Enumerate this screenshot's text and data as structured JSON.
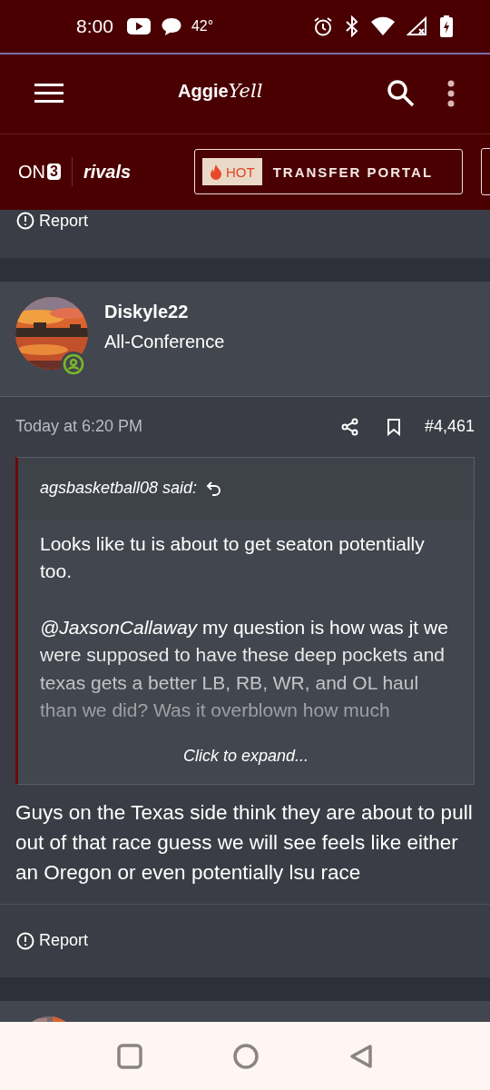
{
  "status_bar": {
    "time": "8:00",
    "temperature": "42°"
  },
  "app_bar": {
    "logo": {
      "bold": "Aggie",
      "script": "Yell"
    }
  },
  "nav": {
    "brand": {
      "on": "ON",
      "three": "3",
      "rivals": "rivals"
    },
    "promo": {
      "badge": "HOT",
      "label": "TRANSFER PORTAL"
    }
  },
  "top_footer": {
    "report": "Report"
  },
  "post": {
    "author": "Diskyle22",
    "rank": "All-Conference",
    "online": true,
    "date": "Today at 6:20 PM",
    "number": "#4,461",
    "quote": {
      "author": "agsbasketball08 said:",
      "paragraphs": [
        {
          "text": "Looks like tu is about to get seaton potentially too."
        },
        {
          "mention": "@JaxsonCallaway",
          "text": "my question is how was jt we were supposed to have these deep pockets and texas gets a better LB, RB, WR, and OL haul than we did? Was it overblown how much"
        }
      ],
      "expand": "Click to expand..."
    },
    "body": "Guys on the Texas side think they are about to pull out of that race guess we will see feels like either an Oregon or even potentially lsu race",
    "report": "Report"
  }
}
